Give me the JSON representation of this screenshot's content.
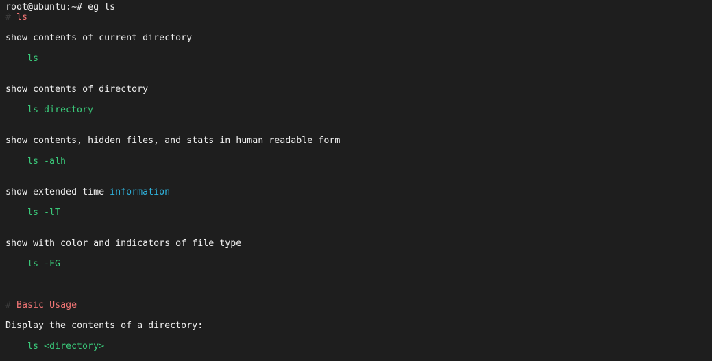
{
  "prompt": {
    "user_host": "root@ubuntu:~#",
    "command": "eg ls"
  },
  "header": {
    "hash": "#",
    "title": "ls"
  },
  "examples": [
    {
      "description": "show contents of current directory",
      "command": "ls"
    },
    {
      "description": "show contents of directory",
      "command": "ls directory"
    },
    {
      "description": "show contents, hidden files, and stats in human readable form",
      "command": "ls -alh"
    },
    {
      "description_prefix": "show extended time ",
      "description_highlight": "information",
      "command": "ls -lT"
    },
    {
      "description": "show with color and indicators of file type",
      "command": "ls -FG"
    }
  ],
  "basic_usage": {
    "hash": "#",
    "heading": "Basic Usage",
    "description": "Display the contents of a directory:",
    "command": "ls <directory>"
  },
  "colors": {
    "background": "#1e1e1e",
    "text": "#eeeeee",
    "command": "#3ac97a",
    "highlight": "#2fb2dc",
    "heading": "#f07474",
    "dim_hash": "#3a3a3a"
  }
}
